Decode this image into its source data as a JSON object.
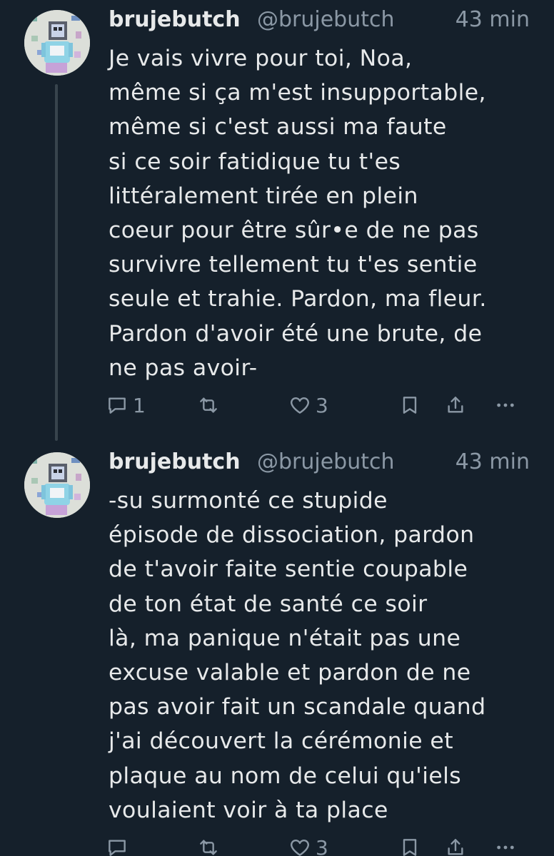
{
  "posts": [
    {
      "author_name": "brujebutch",
      "handle": "@brujebutch",
      "time": "43 min",
      "text": "Je vais vivre pour toi, Noa,\nmême si ça m'est insupportable,\nmême si c'est aussi ma faute\nsi ce soir fatidique tu t'es\nlittéralement tirée en plein\ncoeur pour être sûr•e de ne pas\nsurvivre tellement tu t'es sentie\nseule et trahie. Pardon, ma fleur.\nPardon d'avoir été une brute, de\nne pas avoir-",
      "reply_count": "1",
      "retweet_count": "",
      "like_count": "3"
    },
    {
      "author_name": "brujebutch",
      "handle": "@brujebutch",
      "time": "43 min",
      "text": "-su surmonté ce stupide\népisode de dissociation, pardon\nde t'avoir faite sentie coupable\nde ton état de santé ce soir\nlà, ma panique n'était pas une\nexcuse valable et pardon de ne\npas avoir fait un scandale quand\nj'ai découvert la cérémonie et\nplaque au nom de celui qu'iels\nvoulaient voir à ta place",
      "reply_count": "",
      "retweet_count": "",
      "like_count": "3"
    }
  ],
  "icons": {
    "reply": "reply-icon",
    "retweet": "retweet-icon",
    "like": "heart-icon",
    "bookmark": "bookmark-icon",
    "share": "share-icon",
    "more": "more-icon"
  },
  "colors": {
    "background": "#15202b",
    "text": "#e7e9ea",
    "secondary": "#8b98a5",
    "thread_line": "#38444d"
  }
}
